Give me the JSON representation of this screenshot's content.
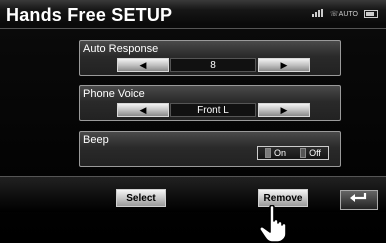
{
  "header": {
    "title": "Hands Free SETUP",
    "status": {
      "signal_icon": "signal-bars-icon",
      "auto_label": "AUTO",
      "battery_icon": "battery-icon"
    }
  },
  "settings": {
    "auto_response": {
      "label": "Auto Response",
      "value": "8",
      "left_icon": "arrow-left-icon",
      "right_icon": "arrow-right-icon"
    },
    "phone_voice": {
      "label": "Phone Voice",
      "value": "Front L",
      "left_icon": "arrow-left-icon",
      "right_icon": "arrow-right-icon"
    },
    "beep": {
      "label": "Beep",
      "on_label": "On",
      "off_label": "Off"
    }
  },
  "bottom": {
    "select_label": "Select",
    "remove_label": "Remove",
    "back_icon": "return-arrow-icon"
  },
  "overlay": {
    "pointer_icon": "pointing-hand-icon"
  }
}
